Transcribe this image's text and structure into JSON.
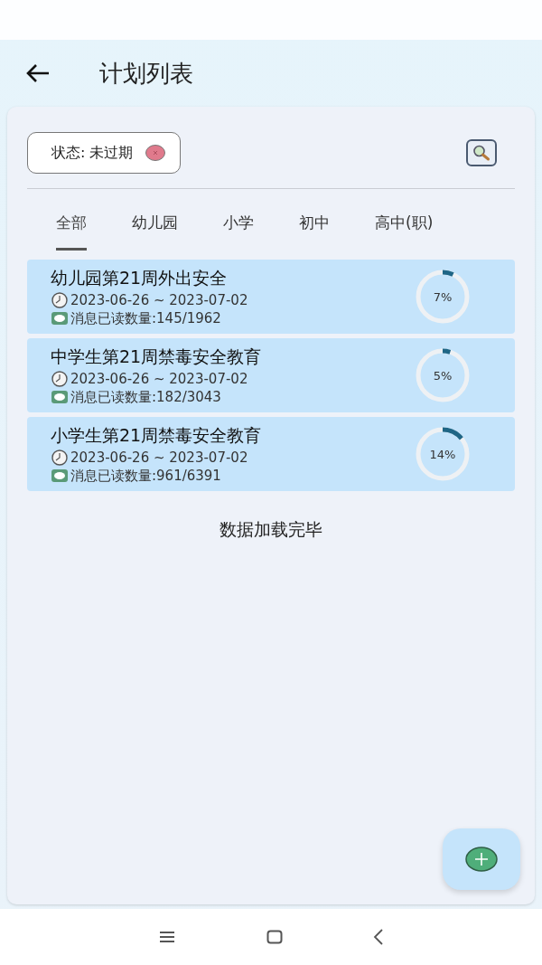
{
  "header": {
    "title": "计划列表"
  },
  "filter": {
    "label": "状态: 未过期"
  },
  "tabs": [
    {
      "label": "全部",
      "selected": true
    },
    {
      "label": "幼儿园",
      "selected": false
    },
    {
      "label": "小学",
      "selected": false
    },
    {
      "label": "初中",
      "selected": false
    },
    {
      "label": "高中(职)",
      "selected": false
    }
  ],
  "plans": [
    {
      "title": "幼儿园第21周外出安全",
      "dates": "2023-06-26 ~ 2023-07-02",
      "read_count": "消息已读数量:145/1962",
      "percent": "7%",
      "level": 0.07
    },
    {
      "title": "中学生第21周禁毒安全教育",
      "dates": "2023-06-26 ~ 2023-07-02",
      "read_count": "消息已读数量:182/3043",
      "percent": "5%",
      "level": 0.05
    },
    {
      "title": "小学生第21周禁毒安全教育",
      "dates": "2023-06-26 ~ 2023-07-02",
      "read_count": "消息已读数量:961/6391",
      "percent": "14%",
      "level": 0.14
    }
  ],
  "footer_note": "数据加载完毕"
}
